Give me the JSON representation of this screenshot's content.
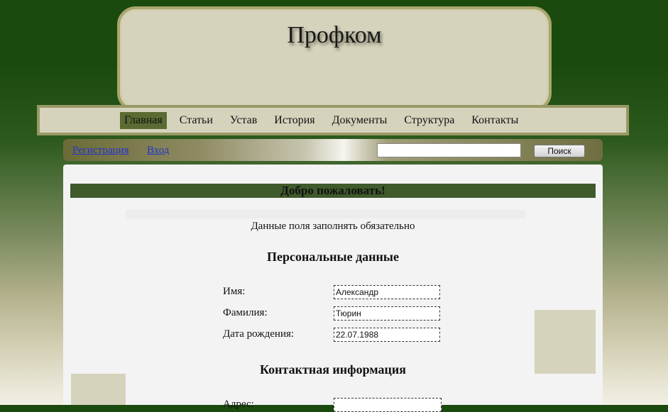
{
  "header": {
    "title": "Профком"
  },
  "nav": {
    "items": [
      {
        "label": "Главная"
      },
      {
        "label": "Статьи"
      },
      {
        "label": "Устав"
      },
      {
        "label": "История"
      },
      {
        "label": "Документы"
      },
      {
        "label": "Структура"
      },
      {
        "label": "Контакты"
      }
    ],
    "active": "Главная"
  },
  "toolbar": {
    "register_label": "Регистрация",
    "login_label": "Вход",
    "search_value": "",
    "search_button_label": "Поиск"
  },
  "main": {
    "welcome": "Добро пожаловать!",
    "required_note": "Данные поля заполнять обязательно",
    "personal_title": "Персональные данные",
    "fields": [
      {
        "label": "Имя:",
        "value": "Александр"
      },
      {
        "label": "Фамилия:",
        "value": "Тюрин"
      },
      {
        "label": "Дата рождения:",
        "value": "22.07.1988"
      }
    ],
    "contact_title": "Контактная информация",
    "address_label": "Адрес:",
    "address_value": ""
  },
  "colors": {
    "background_top": "#1b4a0e",
    "panel": "#d6d3bd",
    "active_nav": "#5b6b33",
    "welcome_bar": "#3f5a2b",
    "link": "#2233cc"
  }
}
